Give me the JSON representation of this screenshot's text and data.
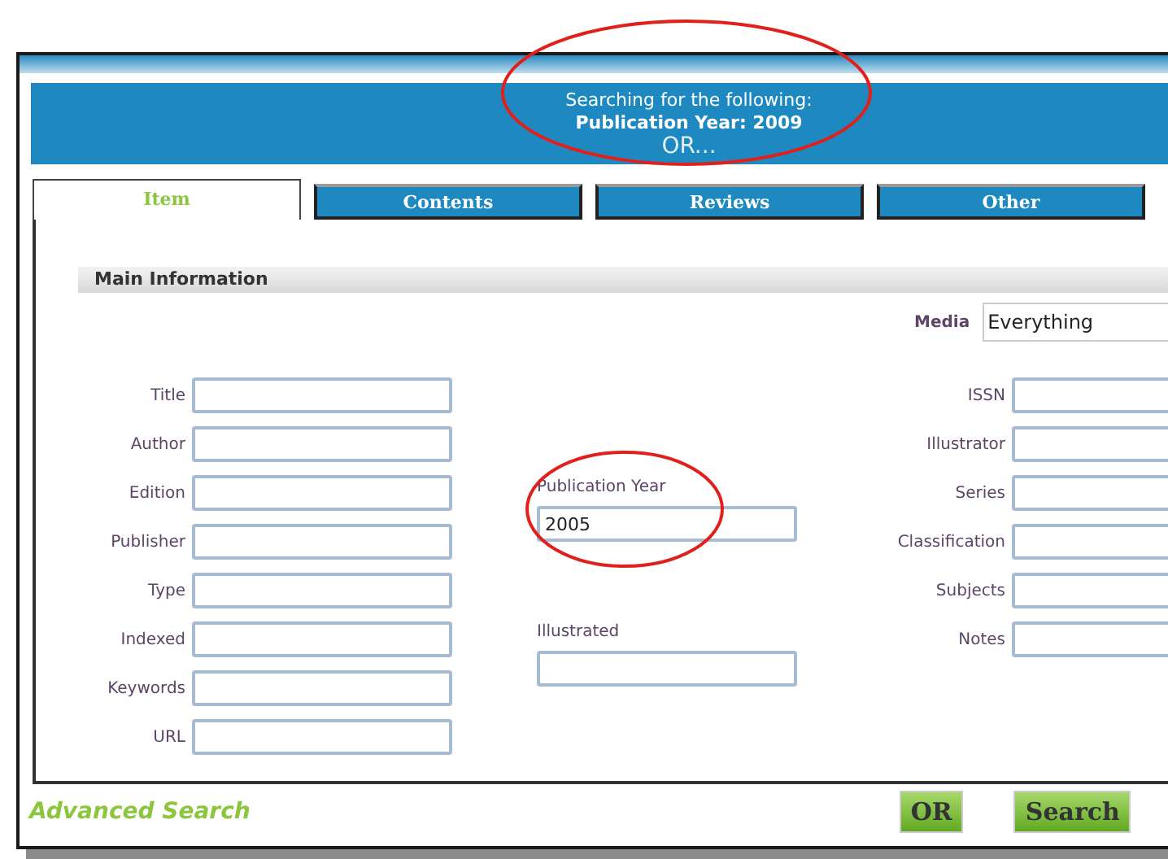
{
  "banner": {
    "heading": "Searching for the following:",
    "criterion": "Publication Year: 2009",
    "connector": "OR..."
  },
  "tabs": [
    {
      "label": "Item",
      "selected": true
    },
    {
      "label": "Contents",
      "selected": false
    },
    {
      "label": "Reviews",
      "selected": false
    },
    {
      "label": "Other",
      "selected": false
    }
  ],
  "section": {
    "title": "Main Information"
  },
  "left_fields": [
    {
      "label": "Title"
    },
    {
      "label": "Author"
    },
    {
      "label": "Edition"
    },
    {
      "label": "Publisher"
    },
    {
      "label": "Type"
    },
    {
      "label": "Indexed"
    },
    {
      "label": "Keywords"
    },
    {
      "label": "URL"
    }
  ],
  "middle_fields": [
    {
      "label": "Publication Year",
      "value": "2005"
    },
    {
      "label": "Illustrated"
    }
  ],
  "media": {
    "label": "Media",
    "value": "Everything"
  },
  "right_fields": [
    {
      "label": "ISSN"
    },
    {
      "label": "Illustrator"
    },
    {
      "label": "Series"
    },
    {
      "label": "Classification"
    },
    {
      "label": "Subjects"
    },
    {
      "label": "Notes"
    }
  ],
  "footer": {
    "link": "Advanced Search",
    "buttons": [
      "OR",
      "Search"
    ]
  }
}
